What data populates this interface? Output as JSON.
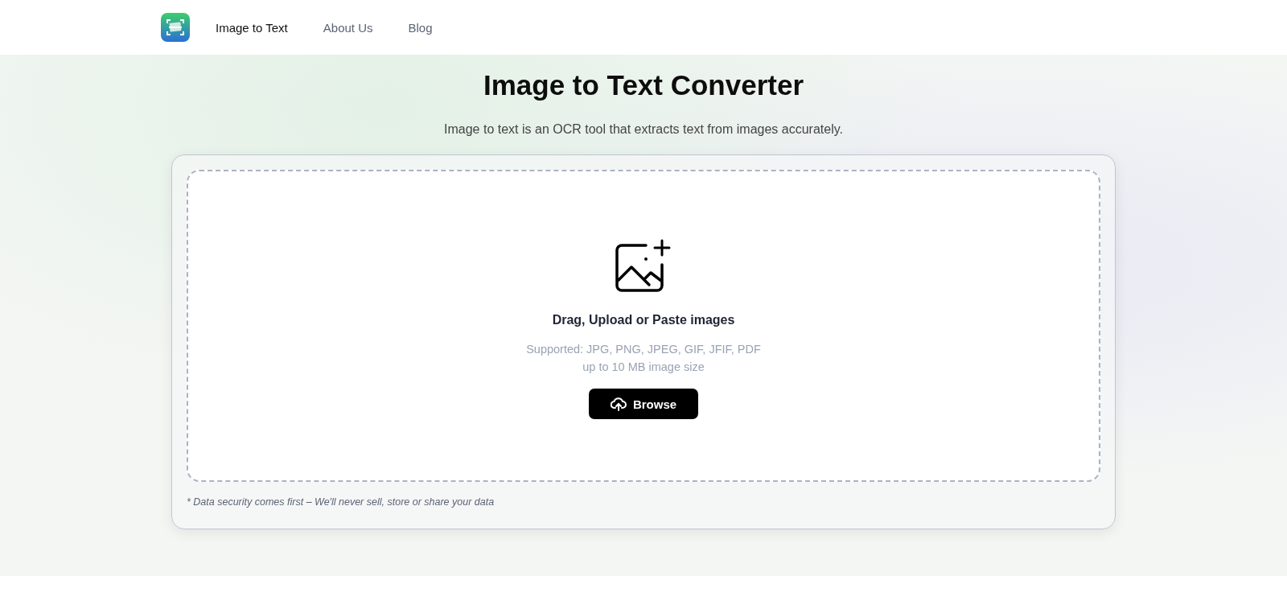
{
  "nav": {
    "items": [
      {
        "label": "Image to Text",
        "selected": true
      },
      {
        "label": "About Us",
        "selected": false
      },
      {
        "label": "Blog",
        "selected": false
      }
    ]
  },
  "hero": {
    "title": "Image to Text Converter",
    "subtitle": "Image to text is an OCR tool that extracts text from images accurately."
  },
  "upload": {
    "heading": "Drag, Upload or Paste images",
    "formats": "Supported: JPG, PNG, JPEG, GIF, JFIF, PDF",
    "size_limit": "up to 10 MB image size",
    "button": "Browse"
  },
  "note": "* Data security comes first – We'll never sell, store or share your data"
}
